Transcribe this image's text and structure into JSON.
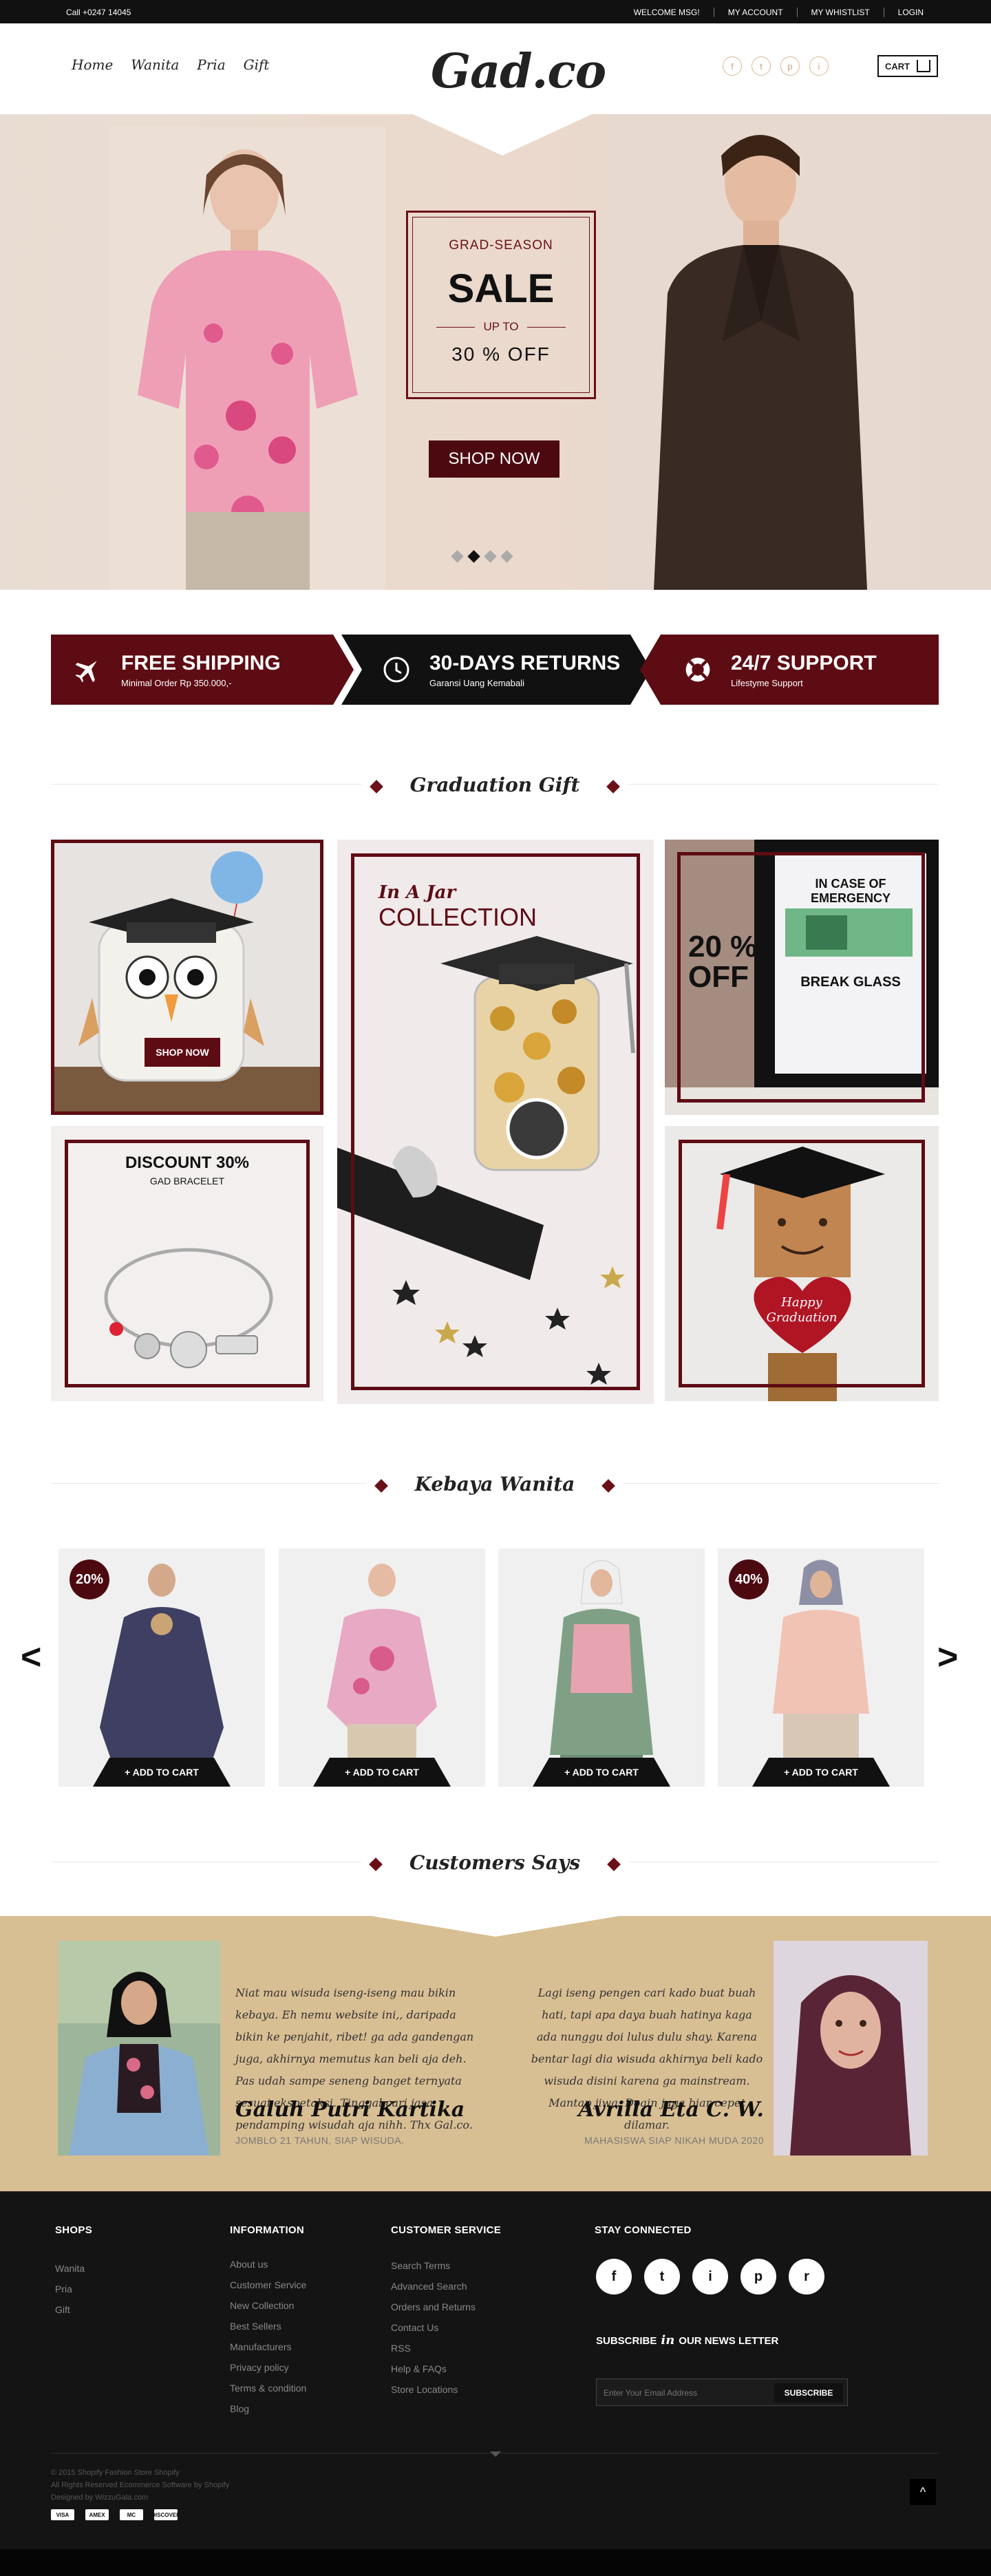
{
  "topbar": {
    "phone": "Call +0247 14045",
    "links": [
      "WELCOME MSG!",
      "MY ACCOUNT",
      "MY WHISTLIST",
      "LOGIN"
    ]
  },
  "header": {
    "nav": [
      "Home",
      "Wanita",
      "Pria",
      "Gift"
    ],
    "logo": "Gad.co",
    "social_icons": [
      "f",
      "t",
      "p",
      "i"
    ],
    "cart_label": "CART"
  },
  "hero": {
    "sale_line1": "GRAD-SEASON",
    "sale_line2": "SALE",
    "sale_line3": "UP TO",
    "sale_line4": "30 % OFF",
    "button": "SHOP NOW",
    "slides": 4,
    "active_slide": 2
  },
  "features": [
    {
      "title": "FREE SHIPPING",
      "sub": "Minimal  Order Rp 350.000,-",
      "icon": "plane-icon"
    },
    {
      "title": "30-DAYS RETURNS",
      "sub": "Garansi Uang Kemabali",
      "icon": "clock-icon"
    },
    {
      "title": "24/7 SUPPORT",
      "sub": "Lifestyme Support",
      "icon": "lifebuoy-icon"
    }
  ],
  "graduation": {
    "title": "Graduation Gift",
    "jar1_button": "SHOP NOW",
    "jar2_h1": "In A Jar",
    "jar2_h2": "COLLECTION",
    "emergency_off": "20 %\nOFF",
    "emergency_sign": "IN CASE OF EMERGENCY",
    "emergency_glass": "BREAK GLASS",
    "bracelet_h1": "DISCOUNT 30%",
    "bracelet_h2": "GAD BRACELET",
    "box_text": "Happy Graduation"
  },
  "kebaya": {
    "title": "Kebaya Wanita",
    "prev": "<",
    "next": ">",
    "cards": [
      {
        "badge": "20%",
        "button": "+ ADD TO CART",
        "color": "#3e3f63"
      },
      {
        "badge": "",
        "button": "+ ADD TO CART",
        "color": "#e8a9c4"
      },
      {
        "badge": "",
        "button": "+ ADD TO CART",
        "color": "#7fa085"
      },
      {
        "badge": "40%",
        "button": "+ ADD TO CART",
        "color": "#f1c3b4"
      }
    ]
  },
  "customers": {
    "title": "Customers Says",
    "left": {
      "quote": "Niat mau wisuda iseng-iseng mau bikin kebaya. Eh nemu website ini,, daripada bikin ke penjahit, ribet! ga ada gandengan juga, akhirnya memutus kan beli aja deh. Pas udah sampe seneng banget ternyata sesuai ekspetaksi. Tinggal cari jasa pendamping wisudah aja nihh. Thx Gal.co.",
      "name": "Galuh Putri Kartika",
      "role": "JOMBLO 21 TAHUN, SIAP WISUDA."
    },
    "right": {
      "quote": "Lagi iseng pengen cari kado buat buah hati, tapi apa daya buah hatinya kaga ada nunggu doi lulus dulu shay. Karena bentar lagi dia wisuda akhirnya beli kado wisuda disini karena ga  mainstream. Mantap jiwa. Doain juga biar cepet dilamar.",
      "name": "Avrilla Eta C. W.",
      "role": "MAHASISWA SIAP NIKAH  MUDA 2020"
    }
  },
  "footer": {
    "shops_title": "SHOPS",
    "shops": [
      "Wanita",
      "Pria",
      "Gift"
    ],
    "info_title": "INFORMATION",
    "info": [
      "About us",
      "Customer Service",
      "New Collection",
      "Best Sellers",
      "Manufacturers",
      "Privacy policy",
      "Terms & condition",
      "Blog"
    ],
    "cs_title": "CUSTOMER SERVICE",
    "cs": [
      "Search Terms",
      "Advanced Search",
      "Orders and Returns",
      "Contact Us",
      "RSS",
      "Help & FAQs",
      "Store Locations"
    ],
    "stay_title": "STAY CONNECTED",
    "social": [
      "f",
      "t",
      "i",
      "p",
      "r"
    ],
    "newsletter_pre": "SUBSCRIBE",
    "newsletter_mid": "in",
    "newsletter_post": "OUR NEWS LETTER",
    "email_placeholder": "Enter Your Email Address",
    "subscribe": "SUBSCRIBE",
    "copyright": [
      "© 2015 Shopify Fashion Store Shopify",
      "All Rights Reserved Ecommerce Software by Shopify",
      "Designed by WizzuGala.com"
    ],
    "payments": [
      "VISA",
      "AMEX",
      "MC",
      "DISCOVER"
    ],
    "to_top": "^"
  }
}
